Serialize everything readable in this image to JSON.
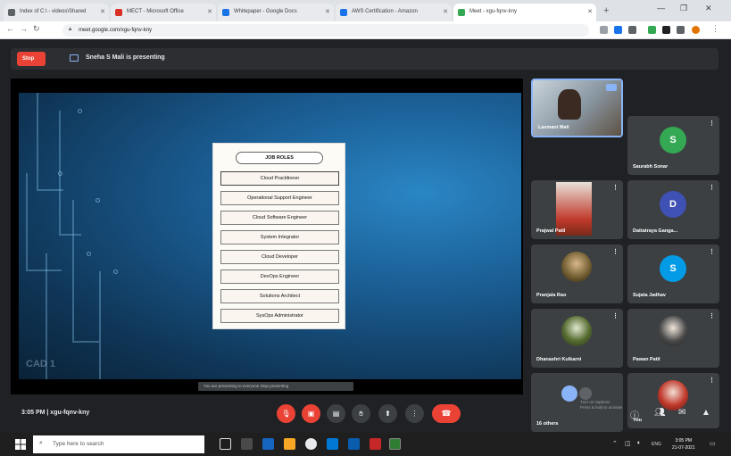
{
  "browser": {
    "tabs": [
      {
        "title": "Index of C:\\ - videos\\Shared",
        "fav": "#5f6368"
      },
      {
        "title": "MECT - Microsoft Office",
        "fav": "#d93025"
      },
      {
        "title": "Whitepaper - Google Docs",
        "fav": "#1a73e8"
      },
      {
        "title": "AWS Certification - Amazon",
        "fav": "#1a73e8"
      },
      {
        "title": "Meet - xgu-fqnv-kny",
        "fav": "#34a853"
      }
    ],
    "new_tab": "+",
    "url": "meet.google.com/xgu-fqnv-kny"
  },
  "presenting": {
    "stop_label": "Stop",
    "text": "Sneha S Mali is presenting"
  },
  "slide": {
    "title": "JOB ROLES",
    "roles": [
      "Cloud Practitioner",
      "Operational Support Engineer",
      "Cloud Software Engineer",
      "System Integrator",
      "Cloud Developer",
      "DevOps Engineer",
      "Solutions Architect",
      "SysOps Administrator"
    ],
    "slide_number": "CAD 1",
    "stage_bar_text": "You are presenting to everyone   Stop presenting"
  },
  "participants": [
    {
      "name": "Laxmani Mali",
      "initial": "",
      "color": "#7a8a96",
      "type": "photo"
    },
    {
      "name": "Saurabh Sonar",
      "initial": "S",
      "color": "#34a853",
      "type": "avatar"
    },
    {
      "name": "Prajwal Patil",
      "initial": "",
      "color": "#c0392b",
      "type": "photo"
    },
    {
      "name": "Dattatraya Ganga...",
      "initial": "D",
      "color": "#3f51b5",
      "type": "avatar"
    },
    {
      "name": "Pranjala Rao",
      "initial": "",
      "color": "#6d5a2e",
      "type": "photo"
    },
    {
      "name": "Sujata Jadhav",
      "initial": "S",
      "color": "#039be5",
      "type": "avatar"
    },
    {
      "name": "Dhanashri Kulkarni",
      "initial": "",
      "color": "#556b2f",
      "type": "photo"
    },
    {
      "name": "Pawan Patil",
      "initial": "",
      "color": "#4a4a4a",
      "type": "photo"
    },
    {
      "name": "16 others",
      "initial": "",
      "color": "#5f6368",
      "type": "group"
    },
    {
      "name": "You",
      "initial": "",
      "color": "#8d6e63",
      "type": "photo"
    }
  ],
  "meeting": {
    "info": "3:05 PM  |  xgu-fqnv-kny"
  },
  "controls": {
    "mic_icon": "mic-off-icon",
    "cam_icon": "camera-off-icon",
    "end_icon": "end-call-icon",
    "hint_line1": "Turn on captions",
    "hint_line2": "Press & hold to activate"
  },
  "taskbar": {
    "search_placeholder": "Type here to search",
    "time": "3:05 PM",
    "date": "21-07-2021"
  }
}
